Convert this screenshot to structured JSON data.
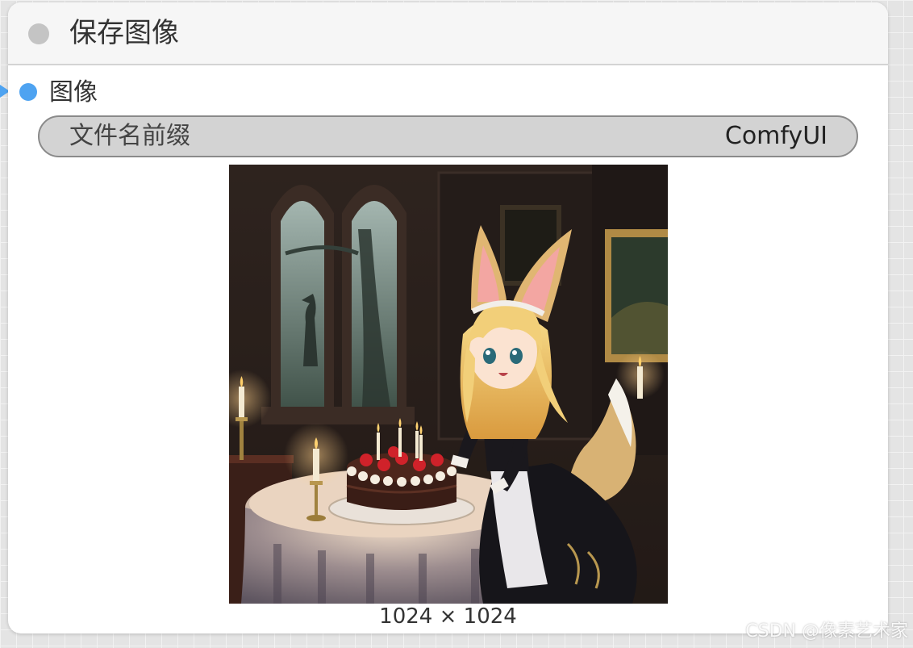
{
  "node": {
    "title": "保存图像",
    "input_label": "图像",
    "widget": {
      "label": "文件名前缀",
      "value": "ComfyUI"
    },
    "image_size": "1024 × 1024"
  },
  "watermark": "CSDN @像素艺术家",
  "colors": {
    "input_slot": "#4ea3f1",
    "collapse_dot": "#c4c4c4",
    "widget_bg": "#d3d3d3"
  },
  "icons": {
    "collapse": "collapse-dot-icon",
    "input_slot": "image-input-slot-icon",
    "link": "link-connector-icon"
  }
}
